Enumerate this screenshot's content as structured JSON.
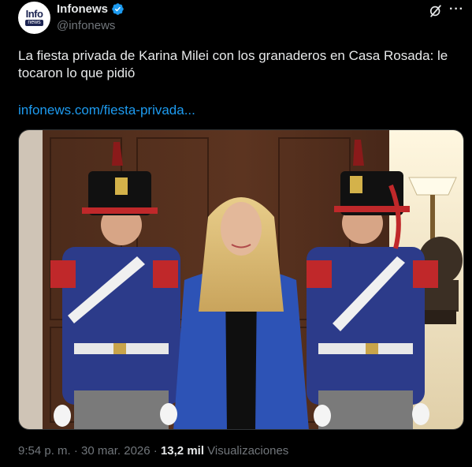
{
  "author": {
    "avatar_top": "Info",
    "avatar_bottom": "news",
    "name": "Infonews",
    "handle": "@infonews"
  },
  "tweet": {
    "text": "La fiesta privada de Karina Milei con los granaderos en Casa Rosada: le tocaron lo que pidió",
    "link": "infonews.com/fiesta-privada..."
  },
  "meta": {
    "time": "9:54 p. m.",
    "separator": " · ",
    "date": "30 mar. 2026",
    "separator2": " · ",
    "views_count": "13,2 mil",
    "views_label": " Visualizaciones"
  },
  "icons": {
    "verified": "verified-badge-icon",
    "grok": "grok-icon",
    "more": "more-options-icon"
  },
  "colors": {
    "background": "#000000",
    "text": "#e7e9ea",
    "muted": "#71767b",
    "link": "#1d9bf0",
    "verified": "#1d9bf0"
  }
}
